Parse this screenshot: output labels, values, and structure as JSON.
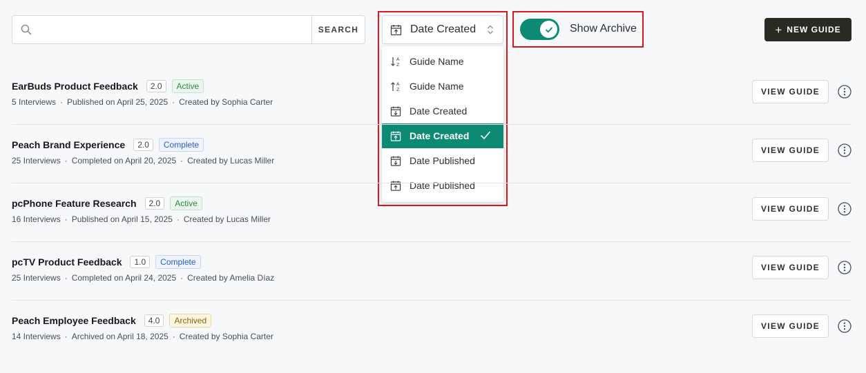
{
  "search": {
    "placeholder": "",
    "value": "",
    "button_label": "SEARCH"
  },
  "sort": {
    "selected_label": "Date Created",
    "options": [
      {
        "label": "Guide Name",
        "icon": "sort-alpha-down-icon"
      },
      {
        "label": "Guide Name",
        "icon": "sort-alpha-up-icon"
      },
      {
        "label": "Date Created",
        "icon": "calendar-down-icon"
      },
      {
        "label": "Date Created",
        "icon": "calendar-up-icon",
        "selected": true
      },
      {
        "label": "Date Published",
        "icon": "calendar-down-icon"
      },
      {
        "label": "Date Published",
        "icon": "calendar-up-icon"
      }
    ]
  },
  "archive_toggle": {
    "label": "Show Archive",
    "on": true
  },
  "new_guide_label": "NEW GUIDE",
  "guides": [
    {
      "title": "EarBuds Product Feedback",
      "version": "2.0",
      "status": "Active",
      "interviews": "5 Interviews",
      "date_text": "Published on April 25, 2025",
      "creator": "Created by Sophia Carter"
    },
    {
      "title": "Peach Brand Experience",
      "version": "2.0",
      "status": "Complete",
      "interviews": "25 Interviews",
      "date_text": "Completed on April 20, 2025",
      "creator": "Created by Lucas Miller"
    },
    {
      "title": "pcPhone Feature Research",
      "version": "2.0",
      "status": "Active",
      "interviews": "16 Interviews",
      "date_text": "Published on April 15, 2025",
      "creator": "Created by Lucas Miller"
    },
    {
      "title": "pcTV Product Feedback",
      "version": "1.0",
      "status": "Complete",
      "interviews": "25 Interviews",
      "date_text": "Completed on April 24, 2025",
      "creator": "Created by Amelia Díaz"
    },
    {
      "title": "Peach Employee Feedback",
      "version": "4.0",
      "status": "Archived",
      "interviews": "14 Interviews",
      "date_text": "Archived on April 18, 2025",
      "creator": "Created by Sophia Carter"
    }
  ],
  "view_guide_label": "VIEW GUIDE",
  "colors": {
    "accent": "#0d8a74",
    "highlight": "#d6191f",
    "primary_button": "#2b2a22"
  }
}
